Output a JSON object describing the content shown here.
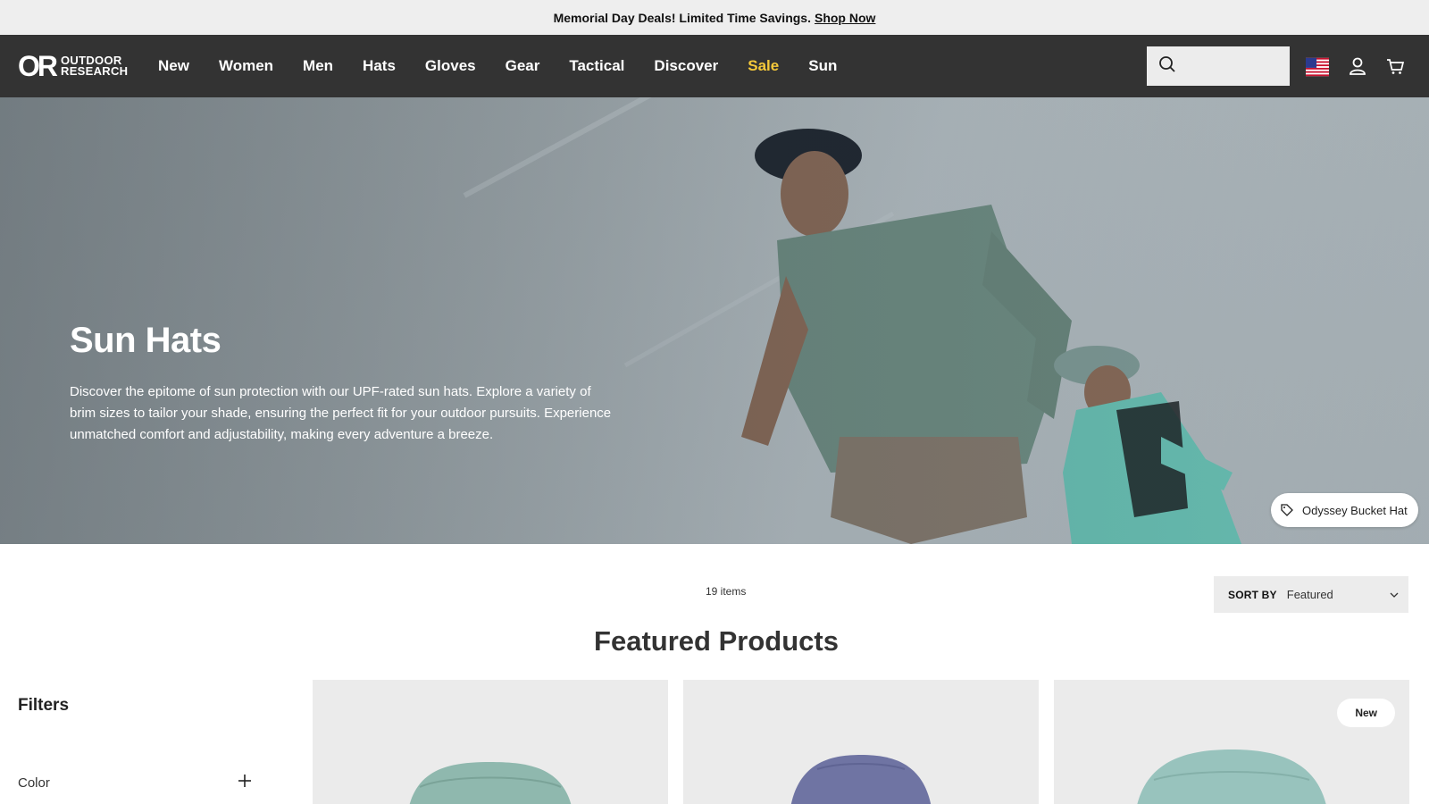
{
  "promo": {
    "text": "Memorial Day Deals! Limited Time Savings.",
    "link": "Shop Now"
  },
  "brand": {
    "mark": "OR",
    "name_line1": "OUTDOOR",
    "name_line2": "RESEARCH"
  },
  "nav": {
    "items": [
      {
        "label": "New"
      },
      {
        "label": "Women"
      },
      {
        "label": "Men"
      },
      {
        "label": "Hats"
      },
      {
        "label": "Gloves"
      },
      {
        "label": "Gear"
      },
      {
        "label": "Tactical"
      },
      {
        "label": "Discover"
      },
      {
        "label": "Sale",
        "color": "#f5c93a"
      },
      {
        "label": "Sun"
      }
    ],
    "search_placeholder": "",
    "icons": [
      "search-icon",
      "us-flag-icon",
      "account-icon",
      "cart-icon"
    ]
  },
  "hero": {
    "title": "Sun Hats",
    "description": "Discover the epitome of sun protection with our UPF-rated sun hats. Explore a variety of brim sizes to tailor your shade, ensuring the perfect fit for your outdoor pursuits. Experience unmatched comfort and adjustability, making every adventure a breeze.",
    "product_tag": "Odyssey Bucket Hat"
  },
  "listing": {
    "count": "19 items",
    "sort_label": "SORT BY",
    "sort_value": "Featured",
    "featured_title": "Featured Products"
  },
  "filters": {
    "title": "Filters",
    "groups": [
      {
        "name": "Color"
      }
    ]
  },
  "products": [
    {
      "badge": "",
      "hat_color": "#8fb8ae"
    },
    {
      "badge": "",
      "hat_color": "#6f74a3"
    },
    {
      "badge": "New",
      "hat_color": "#98c3bd"
    }
  ],
  "colors": {
    "nav_bg": "#333333",
    "promo_bg": "#eeeeee",
    "accent_sale": "#f5c93a",
    "card_bg": "#ebebeb"
  }
}
